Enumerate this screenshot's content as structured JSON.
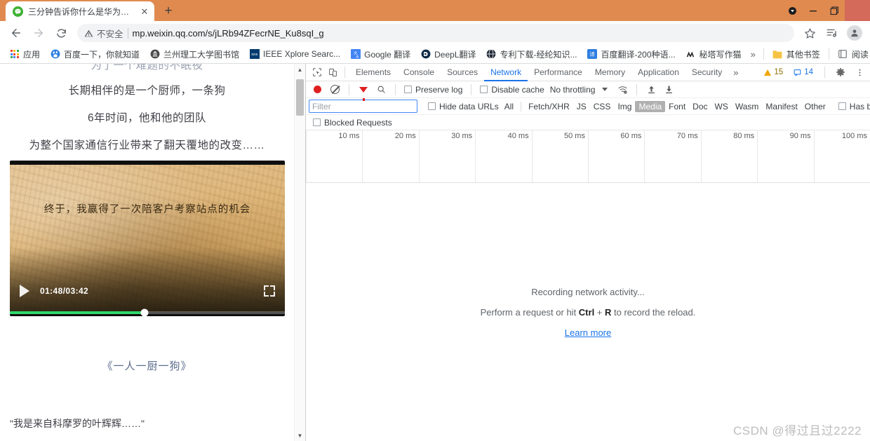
{
  "browser": {
    "tab": {
      "title": "三分钟告诉你什么是华为精神",
      "favicon": "wechat-icon",
      "close_label": "✕"
    },
    "newtab_label": "+",
    "window_controls": {
      "minimize": "—",
      "maximize": "❐",
      "close": "✕",
      "extra": "badge-icon"
    },
    "nav": {
      "back": "←",
      "forward": "→",
      "reload": "⟳"
    },
    "omnibox": {
      "security_label": "不安全",
      "url": "mp.weixin.qq.com/s/jLRb94ZFecrNE_Ku8sqI_g",
      "star": "☆",
      "media_icon": "media-list-icon",
      "avatar": "profile-avatar"
    },
    "bookmarks": {
      "items": [
        {
          "label": "应用",
          "icon": "apps-grid-icon"
        },
        {
          "label": "百度一下，你就知道",
          "icon": "baidu-icon"
        },
        {
          "label": "兰州理工大学图书馆",
          "icon": "library-icon"
        },
        {
          "label": "IEEE Xplore Searc...",
          "icon": "ieee-icon"
        },
        {
          "label": "Google 翻译",
          "icon": "google-translate-icon"
        },
        {
          "label": "DeepL翻译",
          "icon": "deepl-icon"
        },
        {
          "label": "专利下载-经纶知识...",
          "icon": "globe-icon"
        },
        {
          "label": "百度翻译-200种语...",
          "icon": "baidu-translate-icon"
        },
        {
          "label": "秘塔写作猫",
          "icon": "metaso-icon"
        }
      ],
      "overflow": "»",
      "other_bookmarks": {
        "label": "其他书签",
        "icon": "folder-icon"
      },
      "reading_list": {
        "label": "阅读",
        "icon": "reading-list-icon"
      }
    }
  },
  "page": {
    "lines": [
      "为了一个难题的不眠夜",
      "长期相伴的是一个厨师，一条狗",
      "6年时间，他和他的团队",
      "为整个国家通信行业带来了翻天覆地的改变……"
    ],
    "video": {
      "caption": "终于，我赢得了一次陪客户考察站点的机会",
      "time": "01:48/03:42",
      "progress_percent": 49,
      "play_icon": "play-icon",
      "fullscreen_icon": "fullscreen-icon"
    },
    "title": "《一人一厨一狗》",
    "quote": "\"我是来自科摩罗的叶辉辉……\""
  },
  "devtools": {
    "inspect_icon": "inspect-element-icon",
    "device_icon": "device-toolbar-icon",
    "tabs": [
      "Elements",
      "Console",
      "Sources",
      "Network",
      "Performance",
      "Memory",
      "Application",
      "Security"
    ],
    "active_tab": "Network",
    "more_tabs": "»",
    "warnings_count": "15",
    "messages_count": "14",
    "settings_icon": "gear-icon",
    "kebab_icon": "more-vertical-icon",
    "toolbar": {
      "record_icon": "record-icon",
      "clear_icon": "clear-icon",
      "filter_icon": "filter-funnel-icon",
      "search_icon": "search-icon",
      "preserve_log": "Preserve log",
      "disable_cache": "Disable cache",
      "throttling": "No throttling",
      "throttling_caret": "▾",
      "wifi_icon": "network-conditions-icon",
      "import_icon": "import-har-icon",
      "export_icon": "export-har-icon"
    },
    "filter_bar": {
      "placeholder": "Filter",
      "value": "",
      "hide_data_urls": "Hide data URLs",
      "types": [
        "All",
        "Fetch/XHR",
        "JS",
        "CSS",
        "Img",
        "Media",
        "Font",
        "Doc",
        "WS",
        "Wasm",
        "Manifest",
        "Other"
      ],
      "selected_type": "Media",
      "has_blocked_cookies": "Has blocked cooki",
      "blocked_requests": "Blocked Requests"
    },
    "ruler_ticks": [
      "10 ms",
      "20 ms",
      "30 ms",
      "40 ms",
      "50 ms",
      "60 ms",
      "70 ms",
      "80 ms",
      "90 ms",
      "100 ms"
    ],
    "empty_state": {
      "line1": "Recording network activity...",
      "line2_pre": "Perform a request or hit ",
      "line2_key1": "Ctrl",
      "line2_plus": " + ",
      "line2_key2": "R",
      "line2_post": " to record the reload.",
      "link": "Learn more"
    }
  },
  "watermark": "CSDN @得过且过2222",
  "colors": {
    "theme": "#e08a4f",
    "accent": "#1a73e8",
    "record": "#e02020",
    "progress": "#2fd86b"
  }
}
